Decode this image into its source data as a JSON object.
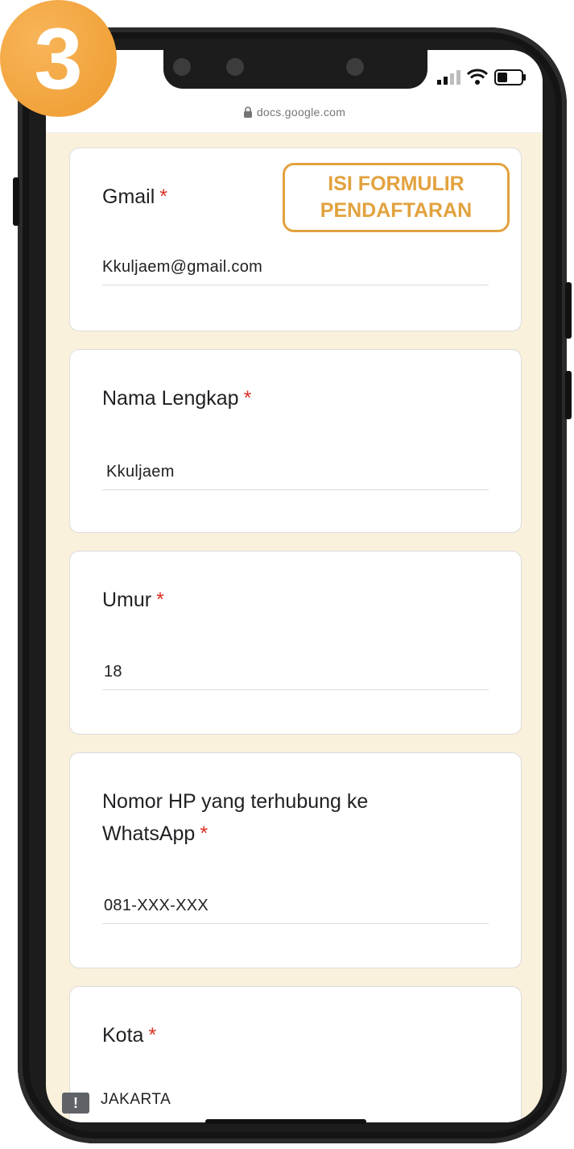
{
  "step": {
    "number": "3"
  },
  "browser": {
    "url": "docs.google.com"
  },
  "badge": {
    "line1": "ISI FORMULIR",
    "line2": "PENDAFTARAN"
  },
  "form": {
    "fields": [
      {
        "label": "Gmail",
        "required": "*",
        "value": "Kkuljaem@gmail.com"
      },
      {
        "label": "Nama Lengkap",
        "required": "*",
        "value": "Kkuljaem"
      },
      {
        "label": "Umur",
        "required": "*",
        "value": "18"
      },
      {
        "label_line1": "Nomor HP yang terhubung ke",
        "label_line2": "WhatsApp",
        "required": "*",
        "value": "081-XXX-XXX"
      },
      {
        "label": "Kota",
        "required": "*",
        "value": "JAKARTA"
      }
    ]
  },
  "colors": {
    "accent": "#e2a23e",
    "page_background": "#faf1dc",
    "required": "#d93025"
  },
  "icons": {
    "lock": "lock-icon",
    "signal": "signal-icon",
    "wifi": "wifi-icon",
    "battery": "battery-icon",
    "alert": "alert-icon"
  }
}
